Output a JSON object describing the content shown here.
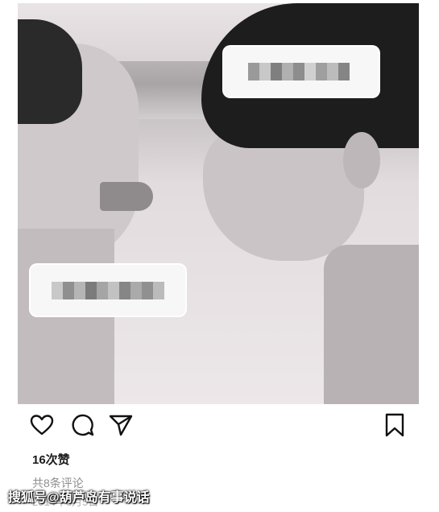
{
  "photo": {
    "label_top": "",
    "label_bottom": ""
  },
  "actions": {
    "like_icon": "heart-outline-icon",
    "comment_icon": "speech-bubble-icon",
    "share_icon": "paper-plane-icon",
    "save_icon": "bookmark-icon"
  },
  "post": {
    "likes": "16次赞",
    "comments": "共8条评论",
    "date": "2014年6月5日"
  },
  "watermark": {
    "text": "搜狐号@葫芦岛有事说话"
  }
}
